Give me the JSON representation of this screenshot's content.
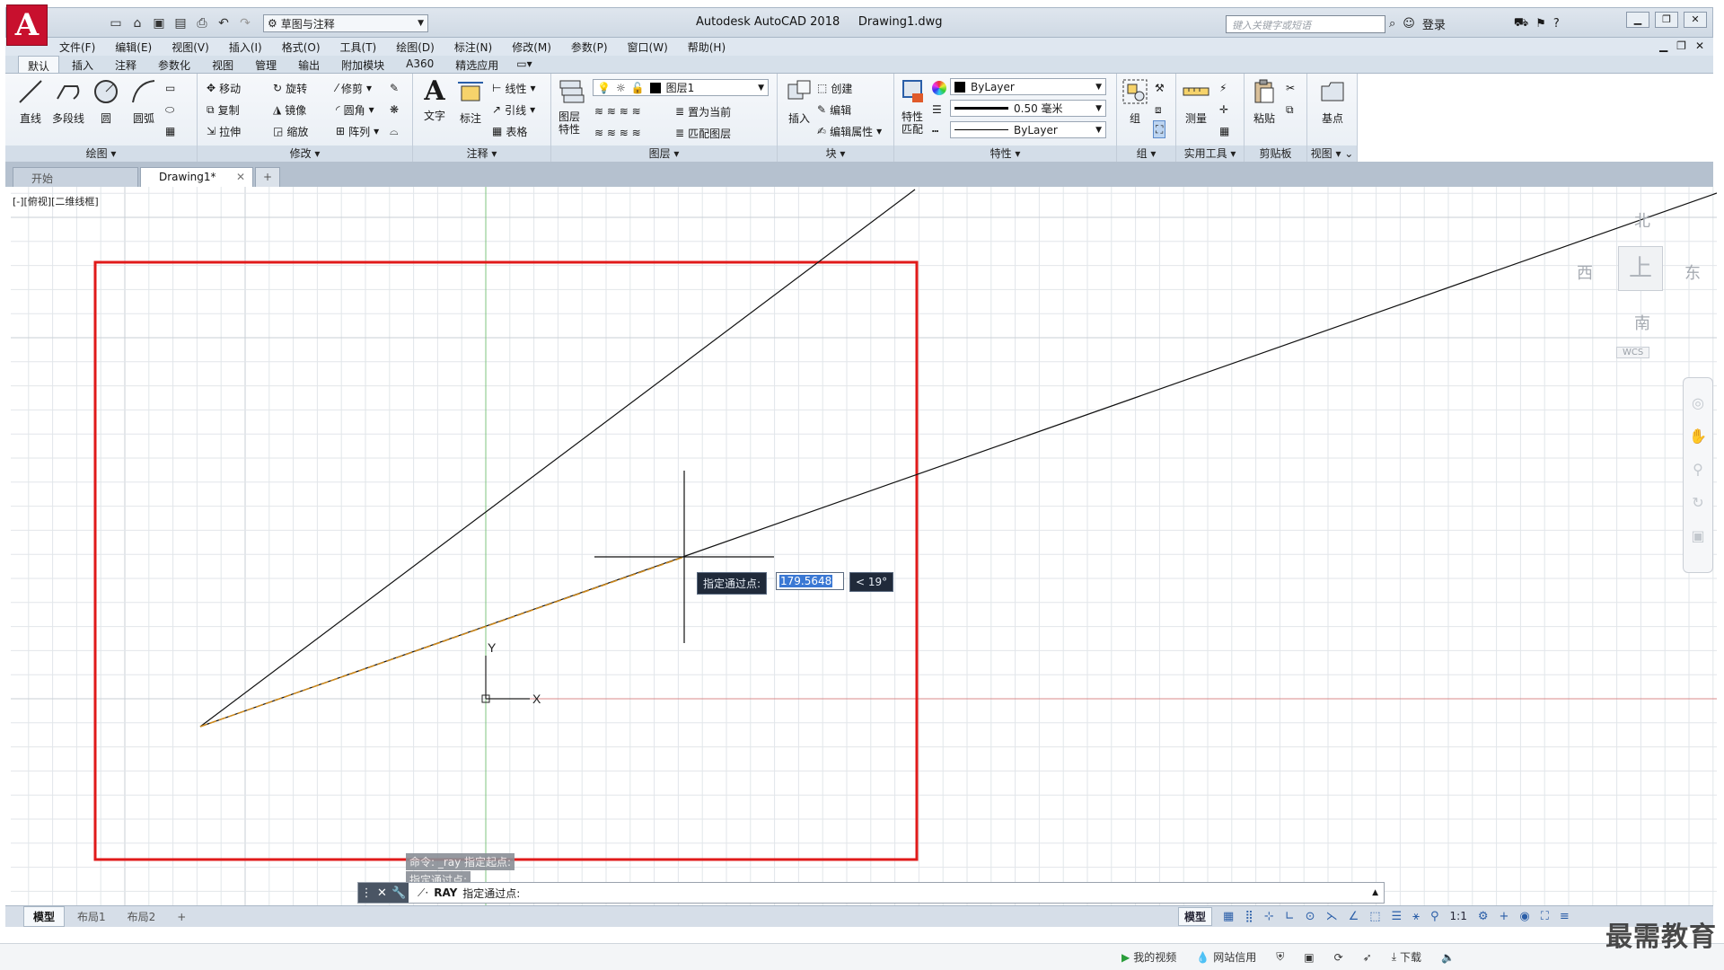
{
  "app": {
    "logo": "A",
    "title": "Autodesk AutoCAD 2018",
    "filename": "Drawing1.dwg",
    "workspace": "草图与注释",
    "search_placeholder": "键入关键字或短语",
    "login": "登录"
  },
  "menu": [
    "文件(F)",
    "编辑(E)",
    "视图(V)",
    "插入(I)",
    "格式(O)",
    "工具(T)",
    "绘图(D)",
    "标注(N)",
    "修改(M)",
    "参数(P)",
    "窗口(W)",
    "帮助(H)"
  ],
  "ribbon_tabs": [
    "默认",
    "插入",
    "注释",
    "参数化",
    "视图",
    "管理",
    "输出",
    "附加模块",
    "A360",
    "精选应用"
  ],
  "ribbon": {
    "draw": {
      "title": "绘图",
      "line": "直线",
      "polyline": "多段线",
      "circle": "圆",
      "arc": "圆弧"
    },
    "modify": {
      "title": "修改",
      "move": "移动",
      "rotate": "旋转",
      "trim": "修剪",
      "copy": "复制",
      "mirror": "镜像",
      "fillet": "圆角",
      "stretch": "拉伸",
      "scale": "缩放",
      "array": "阵列"
    },
    "annotation": {
      "title": "注释",
      "text": "文字",
      "dimension": "标注",
      "linear": "线性",
      "leader": "引线",
      "table": "表格"
    },
    "layers": {
      "title": "图层",
      "layer_props": "图层特性",
      "current_layer": "图层1",
      "set_current": "置为当前",
      "match_layer": "匹配图层"
    },
    "block": {
      "title": "块",
      "insert": "插入",
      "create": "创建",
      "edit": "编辑",
      "edit_attr": "编辑属性"
    },
    "properties": {
      "title": "特性",
      "match": "特性匹配",
      "color": "ByLayer",
      "lineweight": "0.50 毫米",
      "linetype": "ByLayer"
    },
    "groups": {
      "title": "组",
      "group": "组"
    },
    "utilities": {
      "title": "实用工具",
      "measure": "测量"
    },
    "clipboard": {
      "title": "剪贴板",
      "paste": "粘贴"
    },
    "view": {
      "title": "视图",
      "base": "基点"
    }
  },
  "doc_tabs": {
    "start": "开始",
    "drawing": "Drawing1*"
  },
  "viewport": {
    "label": "[-][俯视][二维线框]",
    "viewcube": {
      "north": "北",
      "south": "南",
      "east": "东",
      "west": "西",
      "face": "上",
      "wcs": "WCS"
    },
    "ucs": {
      "x": "X",
      "y": "Y"
    }
  },
  "tooltip": {
    "prompt": "指定通过点:",
    "distance": "179.5648",
    "angle": "< 19°"
  },
  "command": {
    "history_1": "命令: _ray 指定起点:",
    "history_2": "指定通过点:",
    "prompt_name": "RAY",
    "prompt_text": "指定通过点:"
  },
  "layout_tabs": [
    "模型",
    "布局1",
    "布局2"
  ],
  "status": {
    "model": "模型",
    "scale": "1:1"
  },
  "host_bar": {
    "my_video": "我的视频",
    "credit": "网站信用",
    "download": "下载"
  },
  "watermark": "最需教育"
}
